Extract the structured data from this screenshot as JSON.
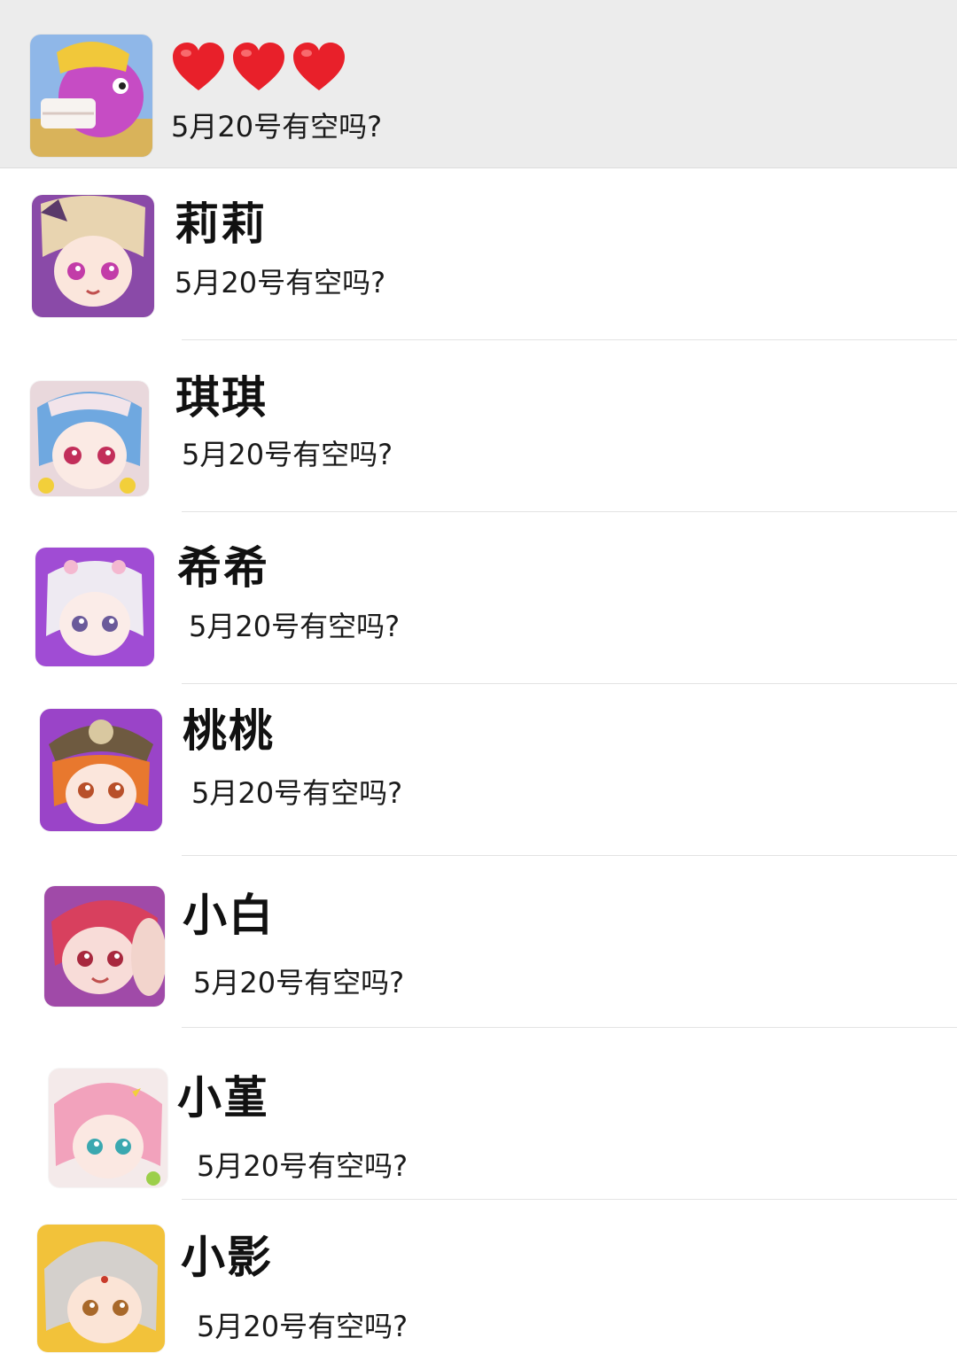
{
  "chats": [
    {
      "name": "",
      "title_icons": [
        "heart-icon",
        "heart-icon",
        "heart-icon"
      ],
      "preview": "5月20号有空吗?",
      "pinned": true,
      "avatar": "avatar-pink-fish-character"
    },
    {
      "name": "莉莉",
      "preview": "5月20号有空吗?",
      "avatar": "avatar-lili"
    },
    {
      "name": "琪琪",
      "preview": "5月20号有空吗?",
      "avatar": "avatar-qiqi"
    },
    {
      "name": "希希",
      "preview": "5月20号有空吗?",
      "avatar": "avatar-xixi"
    },
    {
      "name": "桃桃",
      "preview": "5月20号有空吗?",
      "avatar": "avatar-taotao"
    },
    {
      "name": "小白",
      "preview": "5月20号有空吗?",
      "avatar": "avatar-xiaobai"
    },
    {
      "name": "小堇",
      "preview": "5月20号有空吗?",
      "avatar": "avatar-xiaojin"
    },
    {
      "name": "小影",
      "preview": "5月20号有空吗?",
      "avatar": "avatar-xiaoying"
    }
  ],
  "colors": {
    "pinned_background": "#ececec",
    "heart": "#e8202a",
    "divider": "#e3e3e3"
  }
}
